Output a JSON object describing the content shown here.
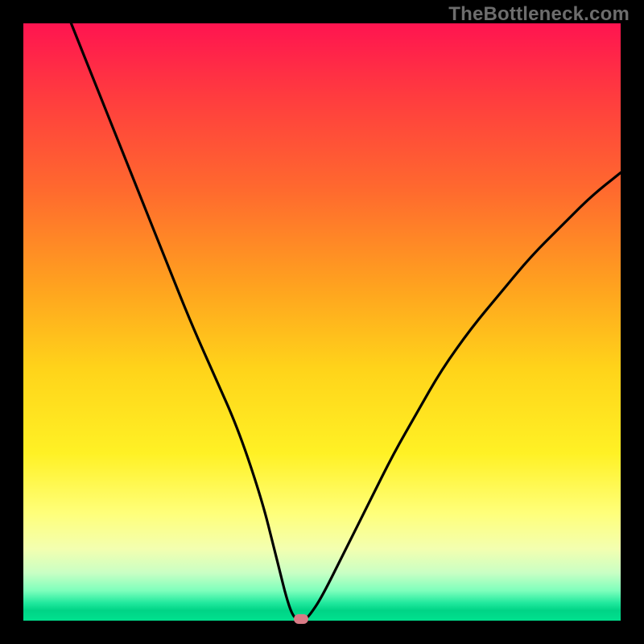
{
  "watermark": "TheBottleneck.com",
  "chart_data": {
    "type": "line",
    "title": "",
    "xlabel": "",
    "ylabel": "",
    "xlim": [
      0,
      100
    ],
    "ylim": [
      0,
      100
    ],
    "grid": false,
    "legend": false,
    "background": "red-yellow-green vertical gradient",
    "series": [
      {
        "name": "bottleneck-curve",
        "x": [
          8,
          12,
          16,
          20,
          24,
          28,
          32,
          36,
          40,
          42,
          43,
          44,
          45,
          46,
          47,
          48,
          50,
          54,
          58,
          62,
          66,
          70,
          75,
          80,
          85,
          90,
          95,
          100
        ],
        "y": [
          100,
          90,
          80,
          70,
          60,
          50,
          41,
          32,
          20,
          12,
          8,
          4,
          1,
          0,
          0,
          1,
          4,
          12,
          20,
          28,
          35,
          42,
          49,
          55,
          61,
          66,
          71,
          75
        ]
      }
    ],
    "annotations": [
      {
        "name": "min-marker",
        "x": 46.5,
        "y": 0,
        "shape": "rounded-rect",
        "color": "#d97b86"
      }
    ]
  },
  "colors": {
    "frame": "#000000",
    "watermark": "#6d6d6d",
    "curve": "#000000",
    "marker": "#d97b86"
  }
}
